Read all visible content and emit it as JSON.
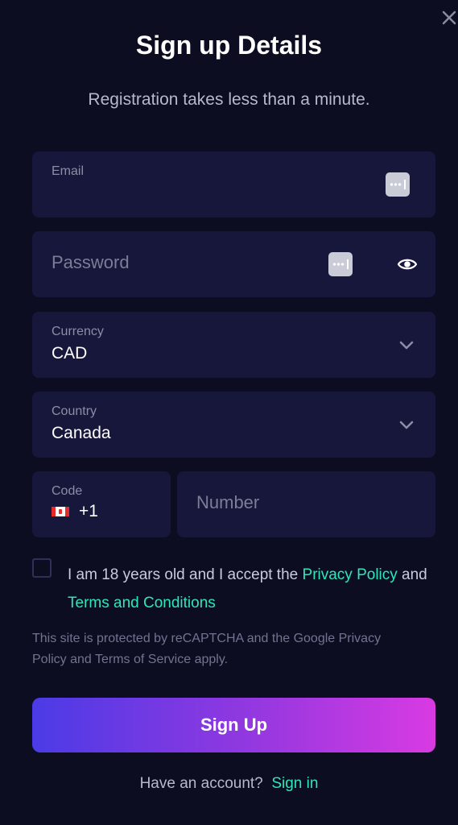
{
  "header": {
    "title": "Sign up Details",
    "subtitle": "Registration takes less than a minute.",
    "close_icon": "close-icon"
  },
  "form": {
    "email": {
      "label": "Email",
      "value": "",
      "icon": "password-manager-key-icon"
    },
    "password": {
      "placeholder": "Password",
      "value": "",
      "icons": [
        "password-manager-key-icon",
        "eye-icon"
      ]
    },
    "currency": {
      "label": "Currency",
      "value": "CAD",
      "icon": "chevron-down-icon"
    },
    "country": {
      "label": "Country",
      "value": "Canada",
      "icon": "chevron-down-icon"
    },
    "code": {
      "label": "Code",
      "value": "+1",
      "flag": "canada-flag-icon"
    },
    "number": {
      "placeholder": "Number",
      "value": ""
    }
  },
  "consent": {
    "checked": false,
    "text_before": "I am 18 years old and I accept the ",
    "privacy_link": "Privacy Policy",
    "text_middle": " and ",
    "terms_link": "Terms and Conditions"
  },
  "recaptcha_note": "This site is protected by reCAPTCHA and the Google Privacy Policy and Terms of Service apply.",
  "submit": {
    "label": "Sign Up"
  },
  "footer": {
    "prompt": "Have an account?",
    "signin_link": "Sign in"
  },
  "colors": {
    "background": "#0d0d22",
    "field_background": "#16173a",
    "accent_link": "#2ee6b9",
    "button_gradient_start": "#4b3be6",
    "button_gradient_end": "#d93ae2"
  }
}
